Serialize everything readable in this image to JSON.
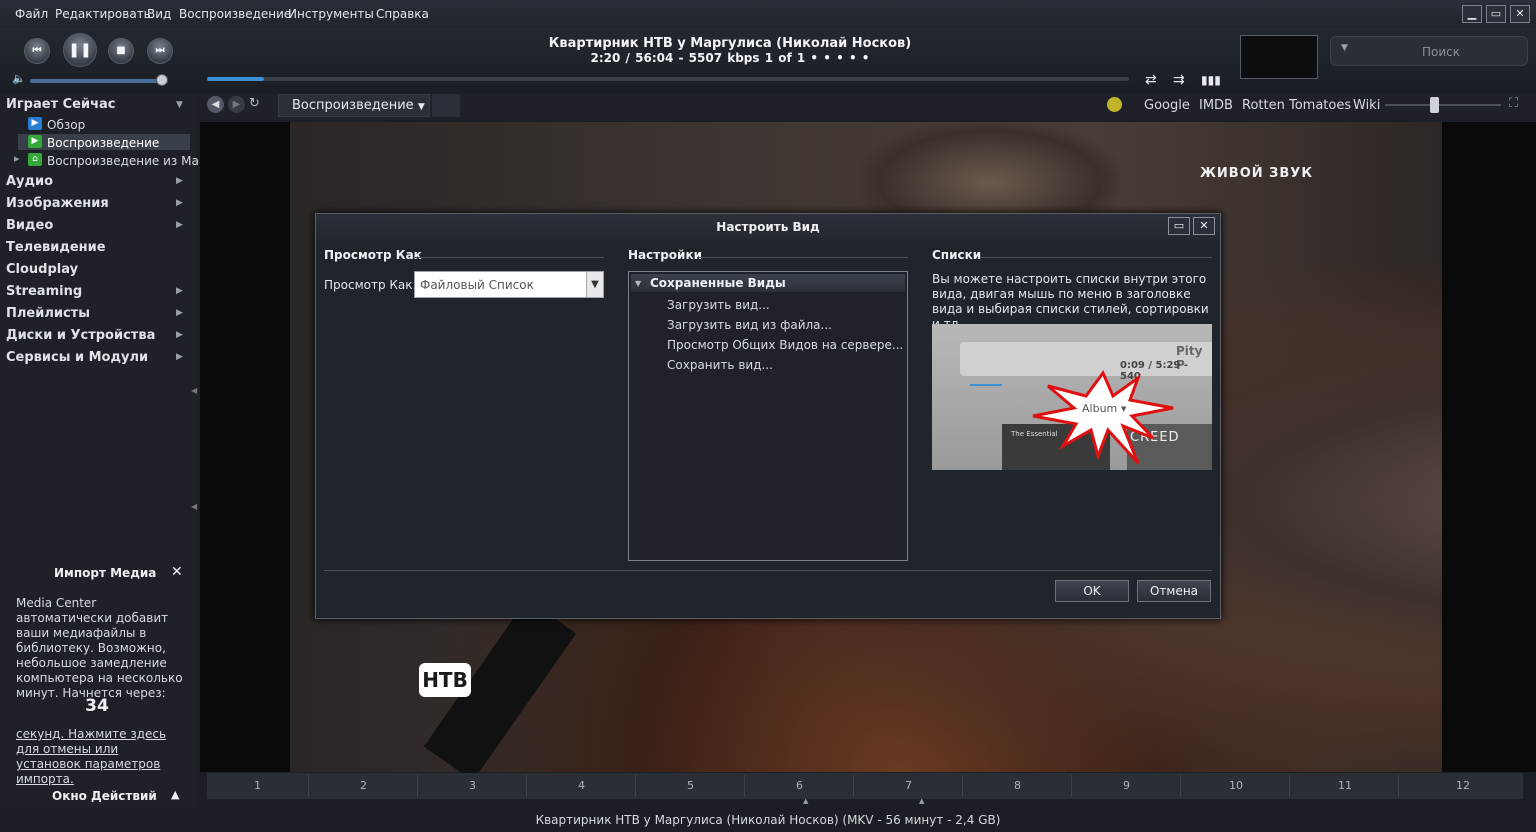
{
  "menu": [
    "Файл",
    "Редактировать",
    "Вид",
    "Воспроизведение",
    "Инструменты",
    "Справка"
  ],
  "player": {
    "title": "Квартирник НТВ у Маргулиса (Николай Носков)",
    "status": "2:20 / 56:04 - 5507 kbps   1 of 1   •  •  •  •  •",
    "progress_fraction": 0.062,
    "volume_fraction": 0.96,
    "search_placeholder": "Поиск"
  },
  "toolbar": {
    "tab_label": "Воспроизведение",
    "links": [
      "Google",
      "IMDB",
      "Rotten Tomatoes",
      "Wiki"
    ]
  },
  "sidebar": {
    "playing_now": "Играет Сейчас",
    "sub_items": [
      "Обзор",
      "Воспроизведение",
      "Воспроизведение из Ма..."
    ],
    "sections": [
      "Аудио",
      "Изображения",
      "Видео",
      "Телевидение",
      "Cloudplay",
      "Streaming",
      "Плейлисты",
      "Диски и Устройства",
      "Сервисы и Модули"
    ]
  },
  "import_panel": {
    "title": "Импорт Медиа",
    "text": "Media Center автоматически добавит ваши медиафайлы в библиотеку. Возможно, небольшое замедление компьютера на несколько минут. Начнется через:",
    "countdown": "34",
    "link": "секунд. Нажмите здесь для отмены или установок параметров импорта.",
    "actions_title": "Окно Действий"
  },
  "video": {
    "overlay_text": "ЖИВОЙ ЗВУК",
    "logo_text": "НТВ"
  },
  "chapters": [
    "1",
    "2",
    "3",
    "4",
    "5",
    "6",
    "7",
    "8",
    "9",
    "10",
    "11",
    "12"
  ],
  "statusbar": "Квартирник НТВ у Маргулиса (Николай Носков) (MKV - 56 минут - 2,4 GB)",
  "dialog": {
    "title": "Настроить Вид",
    "view_as_header": "Просмотр Как",
    "view_as_label": "Просмотр Как:",
    "view_as_value": "Файловый Список",
    "settings_header": "Настройки",
    "saved_views": "Сохраненные Виды",
    "saved_items": [
      "Загрузить вид...",
      "Загрузить вид из файла...",
      "Просмотр Общих Видов на сервере...",
      "Сохранить вид..."
    ],
    "lists_header": "Списки",
    "lists_text": "Вы можете настроить списки внутри этого вида, двигая мышь по меню в заголовке вида и выбирая списки стилей, сортировки и тд.",
    "preview": {
      "title": "Pity P",
      "time": "0:09 / 5:29 - 540",
      "popup": "Album",
      "album1": "The Essential",
      "album2": "CREED"
    },
    "ok": "OK",
    "cancel": "Отмена"
  }
}
